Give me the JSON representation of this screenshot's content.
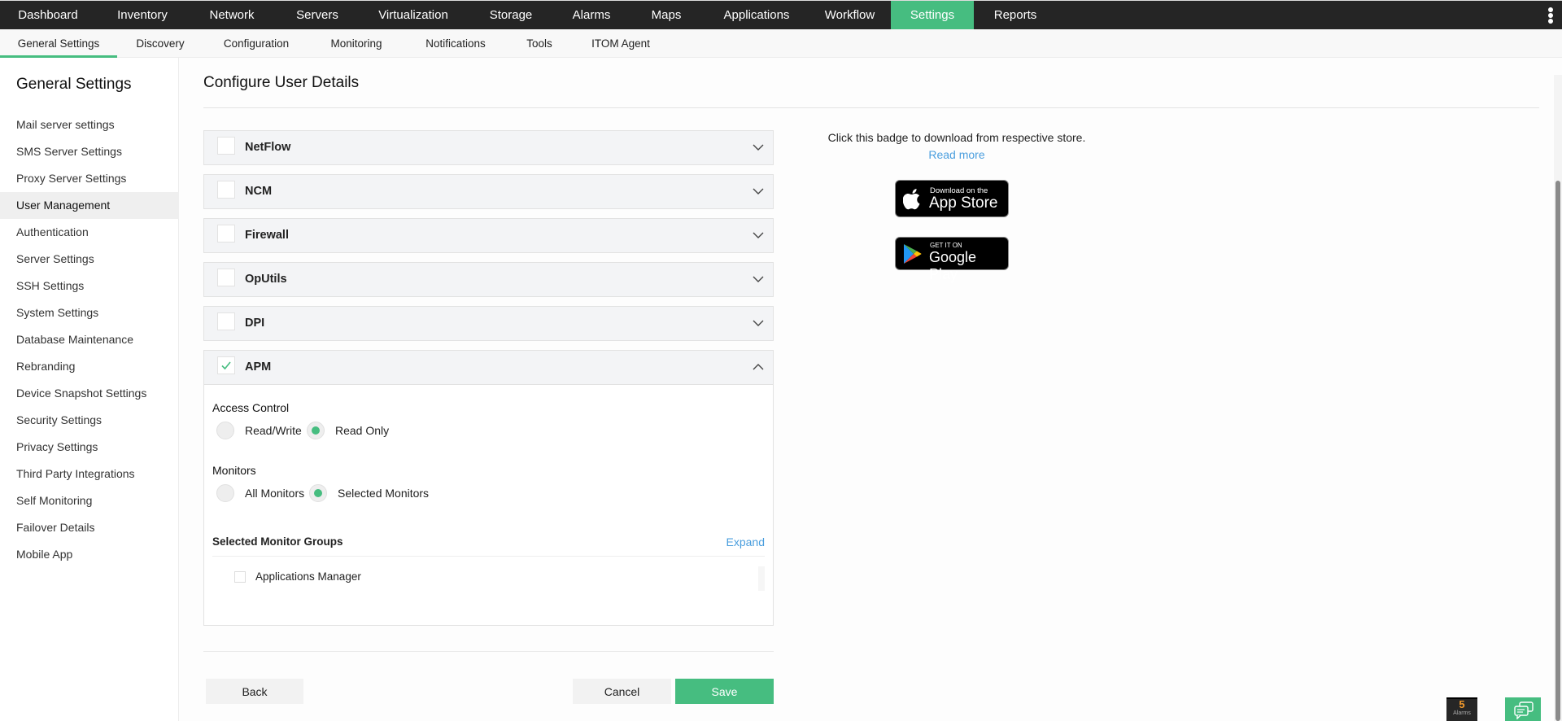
{
  "topnav": {
    "items": [
      {
        "label": "Dashboard"
      },
      {
        "label": "Inventory"
      },
      {
        "label": "Network"
      },
      {
        "label": "Servers"
      },
      {
        "label": "Virtualization"
      },
      {
        "label": "Storage"
      },
      {
        "label": "Alarms"
      },
      {
        "label": "Maps"
      },
      {
        "label": "Applications"
      },
      {
        "label": "Workflow"
      },
      {
        "label": "Settings",
        "active": true
      },
      {
        "label": "Reports"
      }
    ],
    "menu_icon": "kebab-vertical-icon"
  },
  "subnav": {
    "items": [
      {
        "label": "General Settings",
        "active": true
      },
      {
        "label": "Discovery"
      },
      {
        "label": "Configuration"
      },
      {
        "label": "Monitoring"
      },
      {
        "label": "Notifications"
      },
      {
        "label": "Tools"
      },
      {
        "label": "ITOM Agent"
      }
    ]
  },
  "sidebar": {
    "title": "General Settings",
    "items": [
      {
        "label": "Mail server settings"
      },
      {
        "label": "SMS Server Settings"
      },
      {
        "label": "Proxy Server Settings"
      },
      {
        "label": "User Management",
        "active": true
      },
      {
        "label": "Authentication"
      },
      {
        "label": "Server Settings"
      },
      {
        "label": "SSH Settings"
      },
      {
        "label": "System Settings"
      },
      {
        "label": "Database Maintenance"
      },
      {
        "label": "Rebranding"
      },
      {
        "label": "Device Snapshot Settings"
      },
      {
        "label": "Security Settings"
      },
      {
        "label": "Privacy Settings"
      },
      {
        "label": "Third Party Integrations"
      },
      {
        "label": "Self Monitoring"
      },
      {
        "label": "Failover Details"
      },
      {
        "label": "Mobile App"
      }
    ]
  },
  "main": {
    "title": "Configure User Details",
    "modules": [
      {
        "label": "NetFlow",
        "checked": false,
        "expanded": false
      },
      {
        "label": "NCM",
        "checked": false,
        "expanded": false
      },
      {
        "label": "Firewall",
        "checked": false,
        "expanded": false
      },
      {
        "label": "OpUtils",
        "checked": false,
        "expanded": false
      },
      {
        "label": "DPI",
        "checked": false,
        "expanded": false
      },
      {
        "label": "APM",
        "checked": true,
        "expanded": true
      }
    ],
    "apm": {
      "access_control": {
        "label": "Access Control",
        "options": [
          "Read/Write",
          "Read Only"
        ],
        "selected": "Read Only"
      },
      "monitors": {
        "label": "Monitors",
        "options": [
          "All Monitors",
          "Selected Monitors"
        ],
        "selected": "Selected Monitors"
      },
      "groups": {
        "title": "Selected Monitor Groups",
        "expand_label": "Expand",
        "items": [
          {
            "label": "Applications Manager",
            "checked": false
          }
        ]
      }
    },
    "buttons": {
      "back": "Back",
      "cancel": "Cancel",
      "save": "Save"
    }
  },
  "mobile_badges": {
    "info_text": "Click this badge to download from respective store.",
    "read_more": "Read more",
    "app_store": {
      "small": "Download on the",
      "big": "App Store"
    },
    "google_play": {
      "small": "GET IT ON",
      "big": "Google Play"
    }
  },
  "widgets": {
    "alarms": {
      "count": "5",
      "label": "Alarms"
    },
    "chat_icon": "chat-icon"
  },
  "colors": {
    "accent": "#46bd80",
    "topnav_bg": "#252525",
    "link": "#4a9ede",
    "alarm_count": "#f39a2c"
  }
}
